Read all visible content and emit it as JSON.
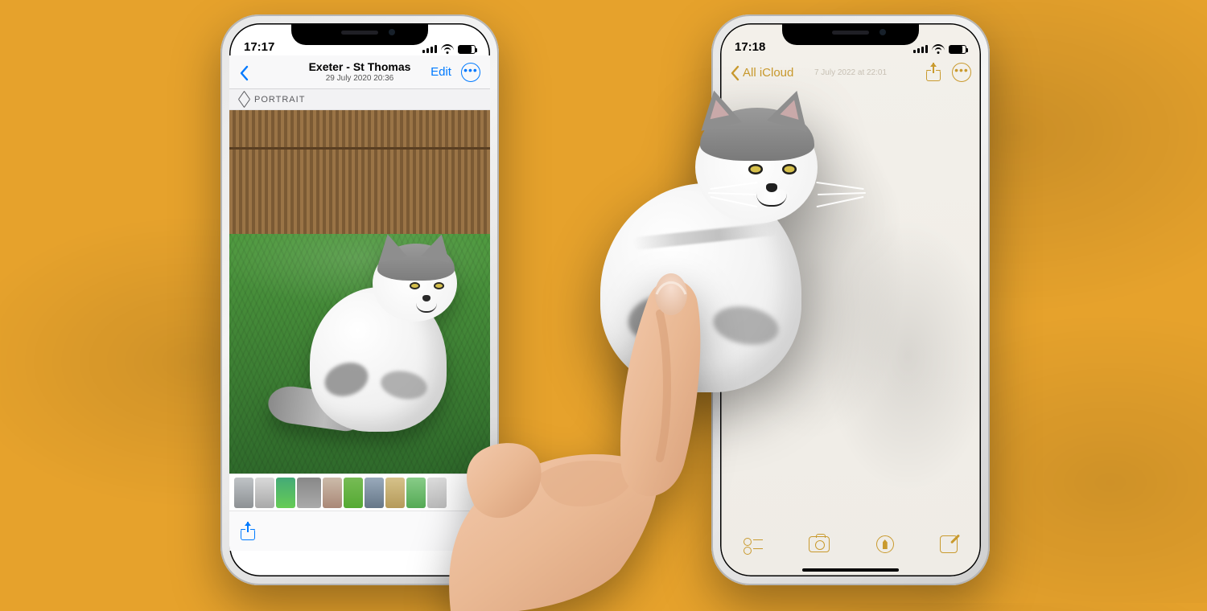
{
  "background": {
    "color": "#e6a22c"
  },
  "phone_left": {
    "status": {
      "time": "17:17"
    },
    "nav": {
      "title": "Exeter - St Thomas",
      "subtitle": "29 July 2020  20:36",
      "edit_label": "Edit",
      "back_icon": "chevron-left-icon",
      "more_icon": "ellipsis-circle-icon",
      "accent": "#007aff"
    },
    "mode_badge": "PORTRAIT",
    "photo": {
      "subject": "fluffy white-and-grey cat",
      "environment": "grass lawn with wooden fence"
    },
    "thumbnails_count": 10,
    "toolbar": {
      "share_icon": "share-icon"
    }
  },
  "phone_right": {
    "status": {
      "time": "17:18"
    },
    "nav": {
      "back_label": "All iCloud",
      "subtitle": "7 July 2022 at 22:01",
      "share_icon": "share-icon",
      "more_icon": "ellipsis-circle-icon",
      "accent": "#c99a2e"
    },
    "toolbar": {
      "items": [
        "checklist-icon",
        "camera-icon",
        "markup-icon",
        "compose-icon"
      ]
    }
  },
  "drag": {
    "subject": "cat cutout",
    "gesture": "index-finger drag-and-drop"
  }
}
